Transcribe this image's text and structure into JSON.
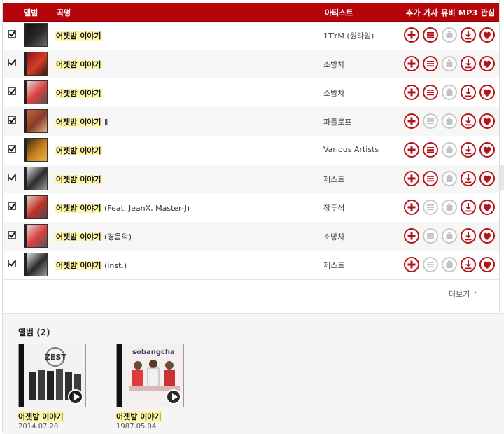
{
  "header": {
    "album_col": "앨범",
    "title_col": "곡명",
    "artist_col": "아티스트",
    "actions_col": "추가 가사 뮤비 MP3 관심"
  },
  "tracks": [
    {
      "title": "어젯밤 이야기",
      "suffix": "",
      "artist": "1TYM (원타임)",
      "lyrics_enabled": true,
      "mv_enabled": false,
      "thumb_colors": [
        "#0e0e0e",
        "#2a2a2a",
        "#6a6a6a"
      ]
    },
    {
      "title": "어젯밤 이야기",
      "suffix": "",
      "artist": "소방차",
      "lyrics_enabled": true,
      "mv_enabled": false,
      "thumb_colors": [
        "#7d1414",
        "#d73b2a",
        "#3a1a10"
      ]
    },
    {
      "title": "어젯밤 이야기",
      "suffix": "",
      "artist": "소방차",
      "lyrics_enabled": true,
      "mv_enabled": false,
      "thumb_colors": [
        "#f0e6e6",
        "#d94040",
        "#555555"
      ]
    },
    {
      "title": "어젯밤 이야기",
      "suffix": " Ⅱ",
      "artist": "파틀로프",
      "lyrics_enabled": false,
      "mv_enabled": false,
      "thumb_colors": [
        "#c46a3c",
        "#8a3a2a",
        "#e2b38a"
      ]
    },
    {
      "title": "어젯밤 이야기",
      "suffix": "",
      "artist": "Various Artists",
      "lyrics_enabled": true,
      "mv_enabled": false,
      "thumb_colors": [
        "#2a1c0c",
        "#c77e1c",
        "#e8b34a"
      ]
    },
    {
      "title": "어젯밤 이야기",
      "suffix": "",
      "artist": "제스트",
      "lyrics_enabled": true,
      "mv_enabled": false,
      "thumb_colors": [
        "#f0f0f0",
        "#2a2a2a",
        "#9a9a9a"
      ]
    },
    {
      "title": "어젯밤 이야기",
      "suffix": " (Feat. JeanX, Master-J)",
      "artist": "장두석",
      "lyrics_enabled": false,
      "mv_enabled": false,
      "thumb_colors": [
        "#e8e0c8",
        "#c4302c",
        "#4a4a4a"
      ]
    },
    {
      "title": "어젯밤 이야기",
      "suffix": " (경음악)",
      "artist": "소방차",
      "lyrics_enabled": false,
      "mv_enabled": false,
      "thumb_colors": [
        "#f0e6e6",
        "#d94040",
        "#555555"
      ]
    },
    {
      "title": "어젯밤 이야기",
      "suffix": " (inst.)",
      "artist": "제스트",
      "lyrics_enabled": false,
      "mv_enabled": false,
      "thumb_colors": [
        "#f0f0f0",
        "#2a2a2a",
        "#9a9a9a"
      ]
    }
  ],
  "more": {
    "label": "더보기"
  },
  "albums_section": {
    "heading": "앨범",
    "count": "(2)",
    "albums": [
      {
        "name": "어젯밤 이야기",
        "date": "2014.07.28",
        "cover_text": "ZEST"
      },
      {
        "name": "어젯밤 이야기",
        "date": "1987.05.04",
        "cover_text": "sobangcha"
      }
    ]
  },
  "colors": {
    "accent": "#b5050a",
    "highlight": "#fff7a8"
  }
}
